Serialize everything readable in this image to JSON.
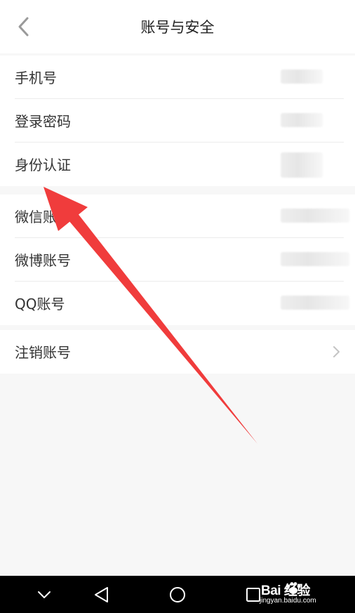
{
  "header": {
    "title": "账号与安全",
    "back_icon": "chevron-left-icon"
  },
  "groups": [
    {
      "rows": [
        {
          "label": "手机号",
          "value_redacted": true
        },
        {
          "label": "登录密码",
          "value_redacted": true
        },
        {
          "label": "身份认证",
          "value_redacted": true
        }
      ]
    },
    {
      "rows": [
        {
          "label": "微信账号",
          "value_redacted": true
        },
        {
          "label": "微博账号",
          "value_redacted": true
        },
        {
          "label": "QQ账号",
          "value_redacted": true
        }
      ]
    },
    {
      "rows": [
        {
          "label": "注销账号",
          "trailing_icon": "chevron-right-icon"
        }
      ]
    }
  ],
  "annotation": {
    "type": "arrow",
    "color": "#f03c3c",
    "points_to": "身份认证"
  },
  "nav_bar": {
    "buttons": [
      "collapse-icon",
      "back-triangle-icon",
      "home-circle-icon",
      "recents-square-icon"
    ]
  },
  "watermark": {
    "brand": "Bai  经验",
    "url": "jingyan.baidu.com"
  },
  "colors": {
    "background": "#f7f7f7",
    "surface": "#ffffff",
    "text": "#333333",
    "divider": "#ececec",
    "arrow": "#f03c3c",
    "navbar": "#000000"
  }
}
